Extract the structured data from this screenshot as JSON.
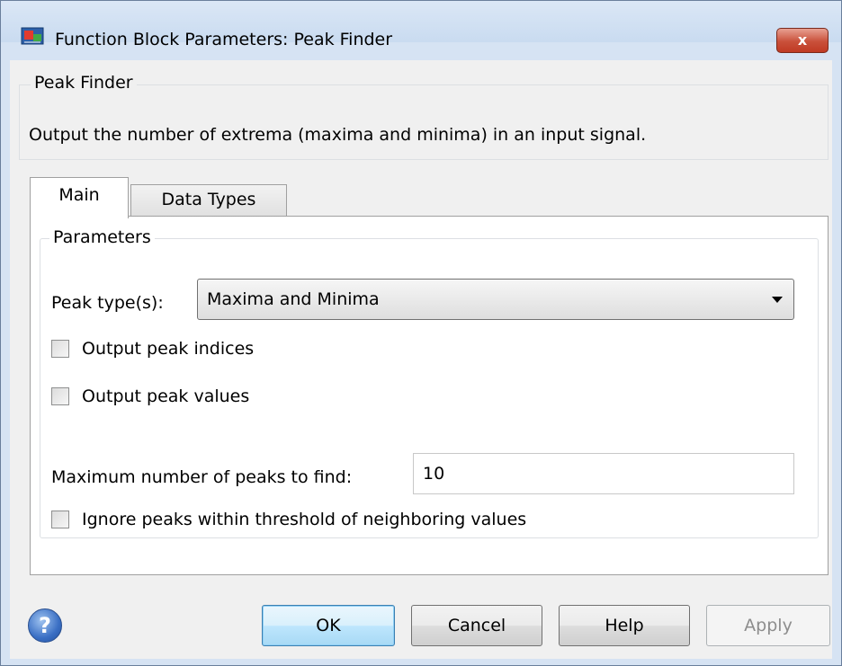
{
  "window": {
    "title": "Function Block Parameters: Peak Finder",
    "close_label": "x"
  },
  "description": {
    "group_label": "Peak Finder",
    "text": "Output the number of extrema (maxima and minima) in an input signal."
  },
  "tabs": [
    {
      "label": "Main",
      "active": true
    },
    {
      "label": "Data Types",
      "active": false
    }
  ],
  "parameters": {
    "group_label": "Parameters",
    "peak_type_label": "Peak type(s):",
    "peak_type_value": "Maxima and Minima",
    "output_peak_indices_label": "Output peak indices",
    "output_peak_indices_checked": false,
    "output_peak_values_label": "Output peak values",
    "output_peak_values_checked": false,
    "max_peaks_label": "Maximum number of peaks to find:",
    "max_peaks_value": "10",
    "ignore_peaks_label": "Ignore peaks within threshold of neighboring values",
    "ignore_peaks_checked": false
  },
  "buttons": {
    "help_icon": "?",
    "ok": "OK",
    "cancel": "Cancel",
    "help": "Help",
    "apply": "Apply"
  },
  "colors": {
    "accent": "#3c7fb1",
    "close": "#c9503a"
  }
}
